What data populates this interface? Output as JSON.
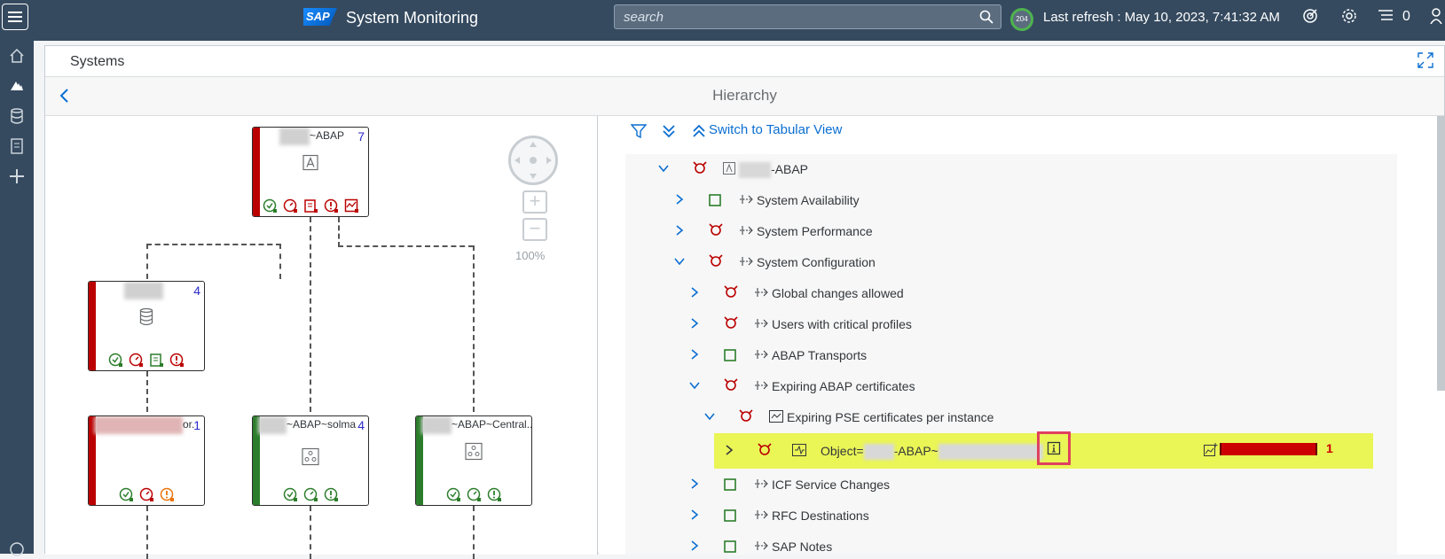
{
  "shell": {
    "app_title": "System Monitoring",
    "logo_text": "SAP",
    "search_placeholder": "search",
    "refresh_badge": "204",
    "last_refresh": "Last refresh : May 10, 2023, 7:41:32 AM",
    "notification_count": "0"
  },
  "frame": {
    "title": "Systems",
    "sub_title": "Hierarchy"
  },
  "graph": {
    "zoom": "100%",
    "nodes": [
      {
        "label": "~ABAP",
        "count": "7",
        "status": "red"
      },
      {
        "label": "",
        "count": "4",
        "status": "red"
      },
      {
        "label": "or.",
        "count": "1",
        "status": "red"
      },
      {
        "label": "~ABAP~solma",
        "count": "4",
        "status": "green"
      },
      {
        "label": "~ABAP~Central...",
        "count": "",
        "status": "green"
      }
    ]
  },
  "tree": {
    "switch_link": "Switch to Tabular View",
    "rows": [
      {
        "label": "-ABAP"
      },
      {
        "label": "System Availability"
      },
      {
        "label": "System Performance"
      },
      {
        "label": "System Configuration"
      },
      {
        "label": "Global changes allowed"
      },
      {
        "label": "Users with critical profiles"
      },
      {
        "label": "ABAP Transports"
      },
      {
        "label": "Expiring ABAP certificates"
      },
      {
        "label": "Expiring PSE certificates per instance"
      },
      {
        "label_prefix": "Object=",
        "label_mid": "-ABAP~",
        "value": "1"
      },
      {
        "label": "ICF Service Changes"
      },
      {
        "label": "RFC Destinations"
      },
      {
        "label": "SAP Notes"
      }
    ]
  },
  "colors": {
    "shell": "#354a5f",
    "alert": "#bb0000",
    "ok": "#2b7d2b",
    "highlight": "#eaf556",
    "link": "#0a6ed1"
  }
}
